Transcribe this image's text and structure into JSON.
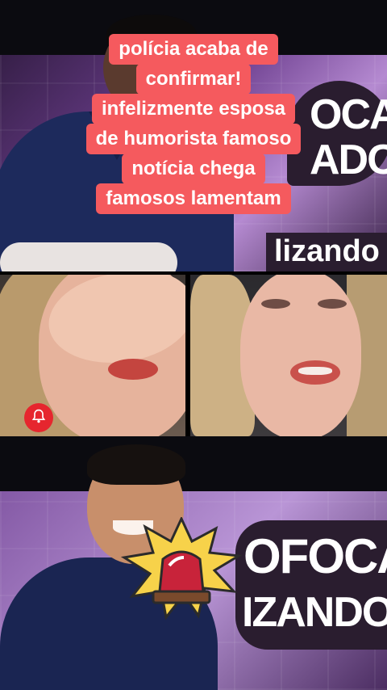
{
  "caption": {
    "lines": [
      "polícia acaba de",
      "confirmar!",
      "infelizmente esposa",
      "de humorista famoso",
      "notícia chega",
      "famosos lamentam"
    ]
  },
  "top_panel": {
    "logo_text": "OCA\nADO",
    "logo_sub": "lizando"
  },
  "bottom_panel": {
    "logo_line1": "OFOCA",
    "logo_line2": "IZANDO"
  },
  "icons": {
    "notification": "bell-icon",
    "alert": "siren-icon"
  },
  "colors": {
    "caption_bg": "#f55a5e",
    "bell_bg": "#e6262e"
  }
}
